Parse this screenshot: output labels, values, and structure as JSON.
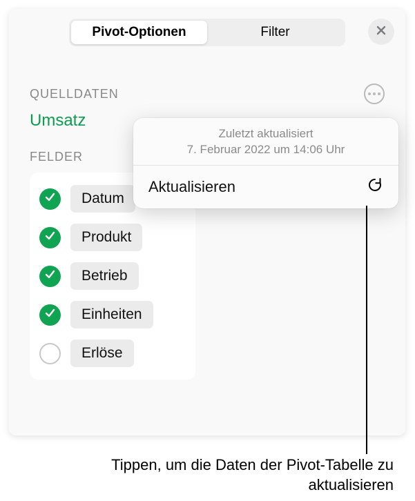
{
  "tabs": {
    "options": "Pivot-Optionen",
    "filter": "Filter"
  },
  "source": {
    "label": "QUELLDATEN",
    "name": "Umsatz"
  },
  "fields": {
    "label": "FELDER",
    "items": [
      {
        "label": "Datum",
        "checked": true
      },
      {
        "label": "Produkt",
        "checked": true
      },
      {
        "label": "Betrieb",
        "checked": true
      },
      {
        "label": "Einheiten",
        "checked": true
      },
      {
        "label": "Erlöse",
        "checked": false
      }
    ]
  },
  "popover": {
    "updated_label": "Zuletzt aktualisiert",
    "updated_time": "7. Februar 2022 um 14:06 Uhr",
    "refresh": "Aktualisieren"
  },
  "callout": "Tippen, um die Daten der Pivot-Tabelle zu aktualisieren"
}
